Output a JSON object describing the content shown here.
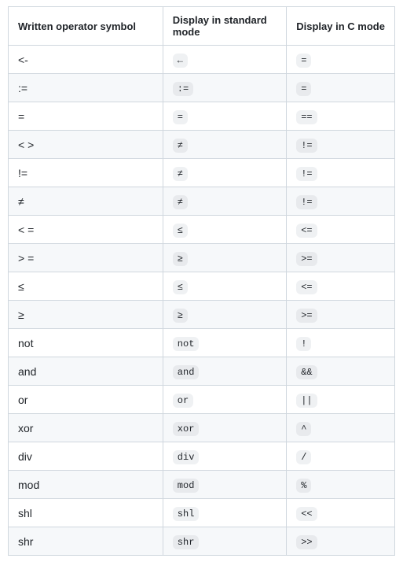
{
  "headers": {
    "col1": "Written operator symbol",
    "col2": "Display in standard mode",
    "col3": "Display in C mode"
  },
  "rows": [
    {
      "written": "<-",
      "std": "←",
      "c": "="
    },
    {
      "written": ":=",
      "std": ":=",
      "c": "="
    },
    {
      "written": "=",
      "std": "=",
      "c": "=="
    },
    {
      "written": "< >",
      "std": "≠",
      "c": "!="
    },
    {
      "written": "!=",
      "std": "≠",
      "c": "!="
    },
    {
      "written": "≠",
      "std": "≠",
      "c": "!="
    },
    {
      "written": "< =",
      "std": "≤",
      "c": "<="
    },
    {
      "written": "> =",
      "std": "≥",
      "c": ">="
    },
    {
      "written": "≤",
      "std": "≤",
      "c": "<="
    },
    {
      "written": "≥",
      "std": "≥",
      "c": ">="
    },
    {
      "written": "not",
      "std": "not",
      "c": "!"
    },
    {
      "written": "and",
      "std": "and",
      "c": "&&"
    },
    {
      "written": "or",
      "std": "or",
      "c": "||"
    },
    {
      "written": "xor",
      "std": "xor",
      "c": "^"
    },
    {
      "written": "div",
      "std": "div",
      "c": "/"
    },
    {
      "written": "mod",
      "std": "mod",
      "c": "%"
    },
    {
      "written": "shl",
      "std": "shl",
      "c": "<<"
    },
    {
      "written": "shr",
      "std": "shr",
      "c": ">>"
    }
  ]
}
